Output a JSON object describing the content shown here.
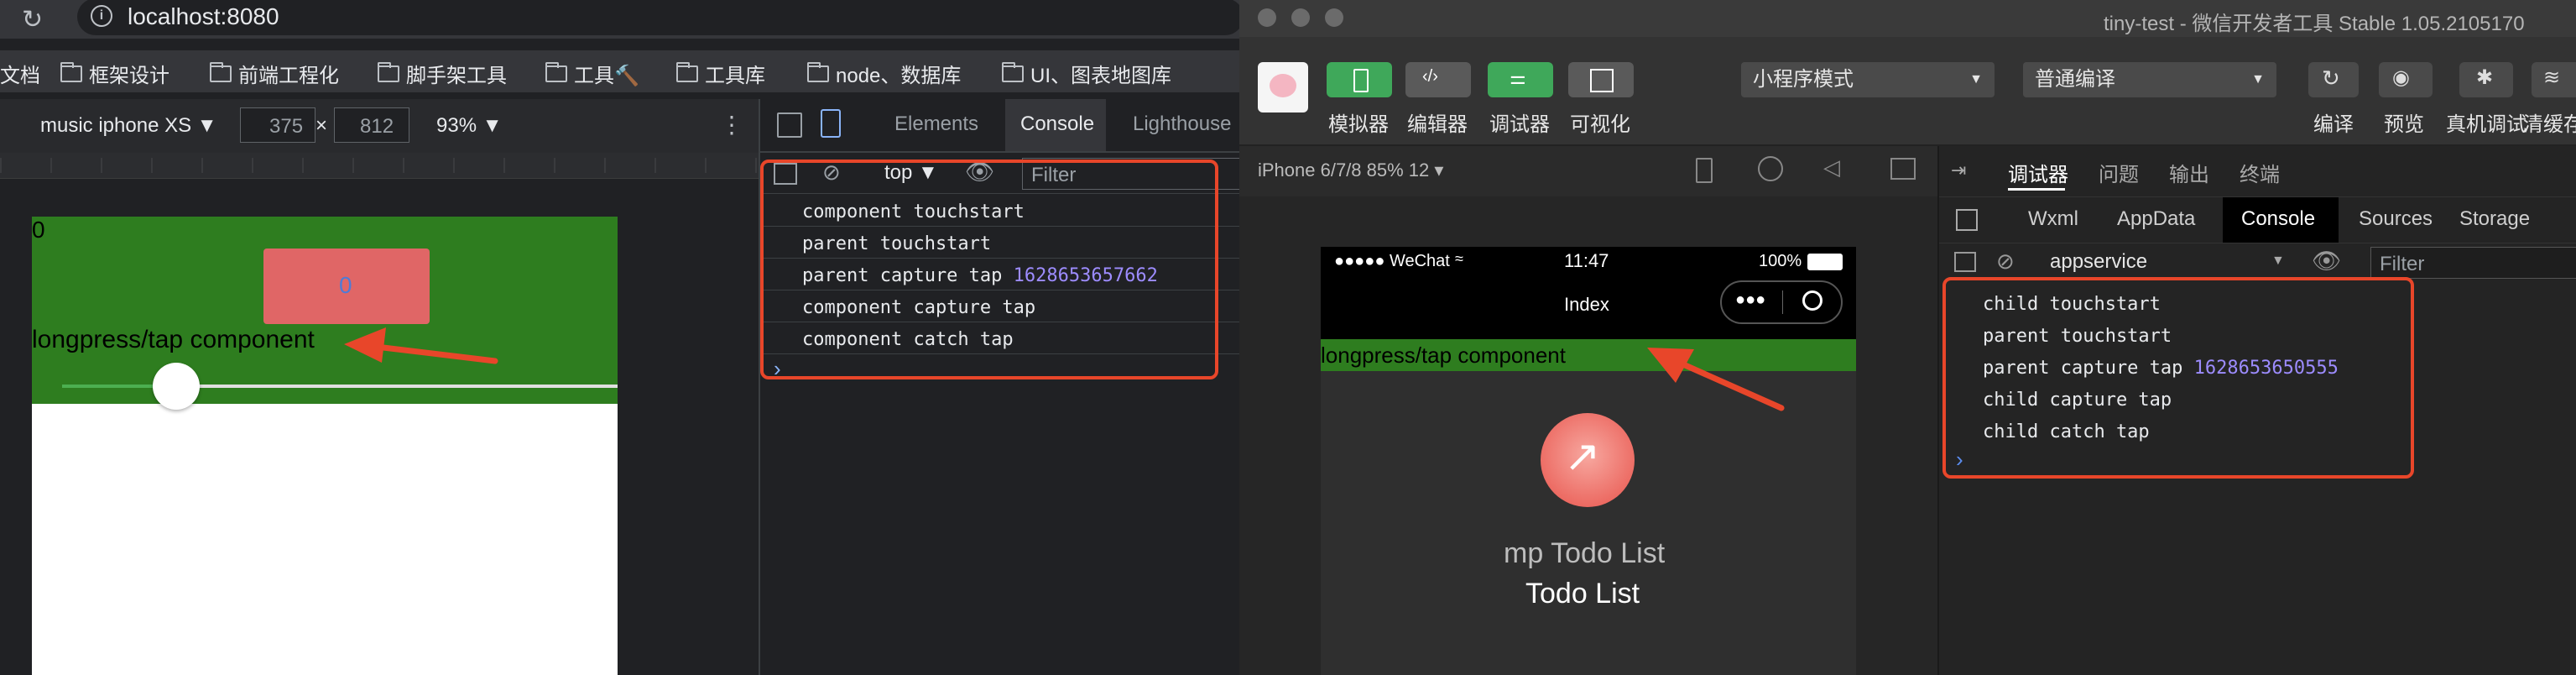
{
  "chrome": {
    "url": "localhost:8080",
    "bookmarks": [
      "文档",
      "框架设计",
      "前端工程化",
      "脚手架工具",
      "工具🔨",
      "工具库",
      "node、数据库",
      "UI、图表地图库"
    ],
    "device": {
      "name": "music iphone XS ▼",
      "width": "375",
      "times": "×",
      "height": "812",
      "zoom": "93% ▼"
    },
    "page": {
      "counter": "0",
      "button_value": "0",
      "component_label": "longpress/tap component"
    },
    "devtools": {
      "tabs": [
        "Elements",
        "Console",
        "Lighthouse"
      ],
      "active_tab": "Console",
      "context": "top ▼",
      "filter_placeholder": "Filter",
      "logs": [
        {
          "text": "component touchstart",
          "num": ""
        },
        {
          "text": "parent touchstart",
          "num": ""
        },
        {
          "text": "parent capture tap ",
          "num": "1628653657662"
        },
        {
          "text": "component capture tap",
          "num": ""
        },
        {
          "text": "component catch tap",
          "num": ""
        }
      ],
      "prompt": "›"
    }
  },
  "wechat": {
    "title": "tiny-test - 微信开发者工具 Stable 1.05.2105170",
    "toolbar": {
      "buttons": [
        "模拟器",
        "编辑器",
        "调试器",
        "可视化"
      ],
      "mode": "小程序模式",
      "compile": "普通编译",
      "actions": [
        "编译",
        "预览",
        "真机调试",
        "清缓存"
      ]
    },
    "sim": {
      "device": "iPhone 6/7/8 85% 12 ▾",
      "status_left": "●●●●● WeChat",
      "time": "11:47",
      "battery": "100%",
      "nav_title": "Index",
      "component_label": "longpress/tap component",
      "app_title": "mp Todo List",
      "app_subtitle": "Todo List"
    },
    "debugger": {
      "top_tabs": [
        "调试器",
        "问题",
        "输出",
        "终端"
      ],
      "tabs": [
        "Wxml",
        "AppData",
        "Console",
        "Sources",
        "Storage"
      ],
      "active_tab": "Console",
      "context": "appservice",
      "filter_placeholder": "Filter",
      "logs": [
        {
          "text": "child touchstart",
          "num": ""
        },
        {
          "text": "parent touchstart",
          "num": ""
        },
        {
          "text": "parent capture tap ",
          "num": "1628653650555"
        },
        {
          "text": "child capture tap",
          "num": ""
        },
        {
          "text": "child catch tap",
          "num": ""
        }
      ],
      "prompt": "›"
    }
  },
  "colors": {
    "accent_red": "#e8462a",
    "green": "#2e7d1f",
    "button_red": "#e06666",
    "toolbar_green": "#3fa85a"
  }
}
